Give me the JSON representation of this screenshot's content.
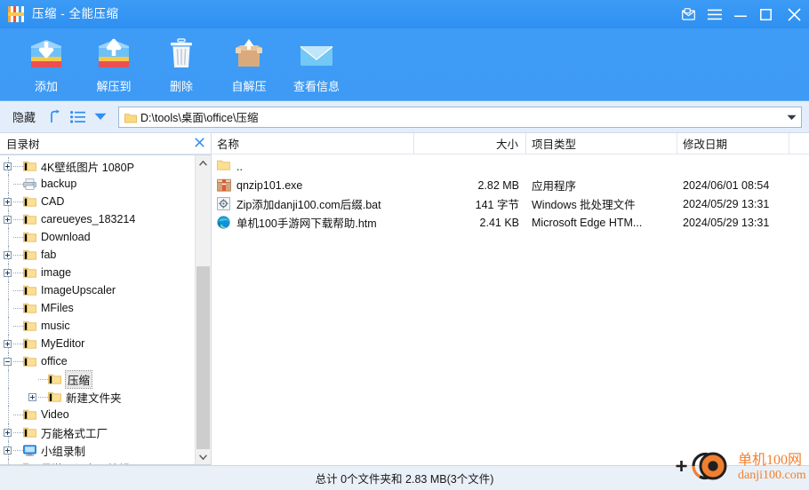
{
  "window": {
    "title": "压缩 - 全能压缩",
    "icon": "archive-app-icon",
    "controls": {
      "feedback": "feedback-mail-icon",
      "menu": "hamburger-menu-icon",
      "minimize": "minimize-icon",
      "maximize": "maximize-icon",
      "close": "close-icon"
    }
  },
  "toolbar": {
    "buttons": [
      {
        "label": "添加",
        "icon": "add-archive-icon"
      },
      {
        "label": "解压到",
        "icon": "extract-to-icon"
      },
      {
        "label": "删除",
        "icon": "trash-icon"
      },
      {
        "label": "自解压",
        "icon": "self-extract-box-icon"
      },
      {
        "label": "查看信息",
        "icon": "envelope-info-icon"
      }
    ]
  },
  "navbar": {
    "hide_label": "隐藏",
    "up_icon": "arrow-up-icon",
    "list_icon": "list-view-icon",
    "dropdown_icon": "chevron-down-icon",
    "path": "D:\\tools\\桌面\\office\\压缩",
    "path_icon": "folder-icon",
    "combo_caret": "chevron-down-icon"
  },
  "tree": {
    "header": "目录树",
    "close_icon": "close-icon",
    "items": [
      {
        "label": "4K壁纸图片 1080P",
        "depth": 0,
        "expander": "plus",
        "icon": "folder-icon",
        "selected": false
      },
      {
        "label": "backup",
        "depth": 0,
        "expander": "none",
        "icon": "printer-icon",
        "selected": false
      },
      {
        "label": "CAD",
        "depth": 0,
        "expander": "plus",
        "icon": "folder-icon",
        "selected": false
      },
      {
        "label": "careueyes_183214",
        "depth": 0,
        "expander": "plus",
        "icon": "folder-icon",
        "selected": false
      },
      {
        "label": "Download",
        "depth": 0,
        "expander": "none",
        "icon": "folder-icon",
        "selected": false
      },
      {
        "label": "fab",
        "depth": 0,
        "expander": "plus",
        "icon": "folder-icon",
        "selected": false
      },
      {
        "label": "image",
        "depth": 0,
        "expander": "plus",
        "icon": "folder-icon",
        "selected": false
      },
      {
        "label": "ImageUpscaler",
        "depth": 0,
        "expander": "none",
        "icon": "folder-icon",
        "selected": false
      },
      {
        "label": "MFiles",
        "depth": 0,
        "expander": "none",
        "icon": "folder-icon",
        "selected": false
      },
      {
        "label": "music",
        "depth": 0,
        "expander": "none",
        "icon": "folder-icon",
        "selected": false
      },
      {
        "label": "MyEditor",
        "depth": 0,
        "expander": "plus",
        "icon": "folder-icon",
        "selected": false
      },
      {
        "label": "office",
        "depth": 0,
        "expander": "minus",
        "icon": "folder-icon",
        "selected": false
      },
      {
        "label": "压缩",
        "depth": 1,
        "expander": "none",
        "icon": "folder-icon",
        "selected": true
      },
      {
        "label": "新建文件夹",
        "depth": 1,
        "expander": "plus",
        "icon": "folder-icon",
        "selected": false
      },
      {
        "label": "Video",
        "depth": 0,
        "expander": "none",
        "icon": "folder-icon",
        "selected": false
      },
      {
        "label": "万能格式工厂",
        "depth": 0,
        "expander": "plus",
        "icon": "folder-icon",
        "selected": false
      },
      {
        "label": "小组录制",
        "depth": 0,
        "expander": "plus",
        "icon": "monitor-icon",
        "selected": false
      },
      {
        "label": "星游网汇专用编辑器",
        "depth": 0,
        "expander": "plus",
        "icon": "folder-icon",
        "selected": false
      }
    ],
    "scrollbar": {
      "up_icon": "chevron-up-icon",
      "down_icon": "chevron-down-icon"
    }
  },
  "filelist": {
    "columns": [
      "名称",
      "大小",
      "项目类型",
      "修改日期"
    ],
    "rows": [
      {
        "name": "..",
        "icon": "folder-up-icon",
        "size": "",
        "type": "",
        "date": ""
      },
      {
        "name": "qnzip101.exe",
        "icon": "exe-archive-icon",
        "size": "2.82 MB",
        "type": "应用程序",
        "date": "2024/06/01  08:54"
      },
      {
        "name": "Zip添加danji100.com后缀.bat",
        "icon": "bat-script-icon",
        "size": "141 字节",
        "type": "Windows 批处理文件",
        "date": "2024/05/29  13:31"
      },
      {
        "name": "单机100手游网下载帮助.htm",
        "icon": "edge-browser-icon",
        "size": "2.41 KB",
        "type": "Microsoft Edge HTM...",
        "date": "2024/05/29  13:31"
      }
    ]
  },
  "statusbar": {
    "text": "总计 0个文件夹和 2.83 MB(3个文件)"
  },
  "watermark": {
    "line1": "单机100网",
    "line2": "danji100.com",
    "color": "#f08030",
    "icon": "danji100-logo-icon"
  },
  "colors": {
    "titlebar": "#3b9bf5",
    "ribbon": "#3f9cf6",
    "navbar": "#e4eefb",
    "statusbar": "#e9f0f7",
    "accent": "#2f90f2"
  }
}
